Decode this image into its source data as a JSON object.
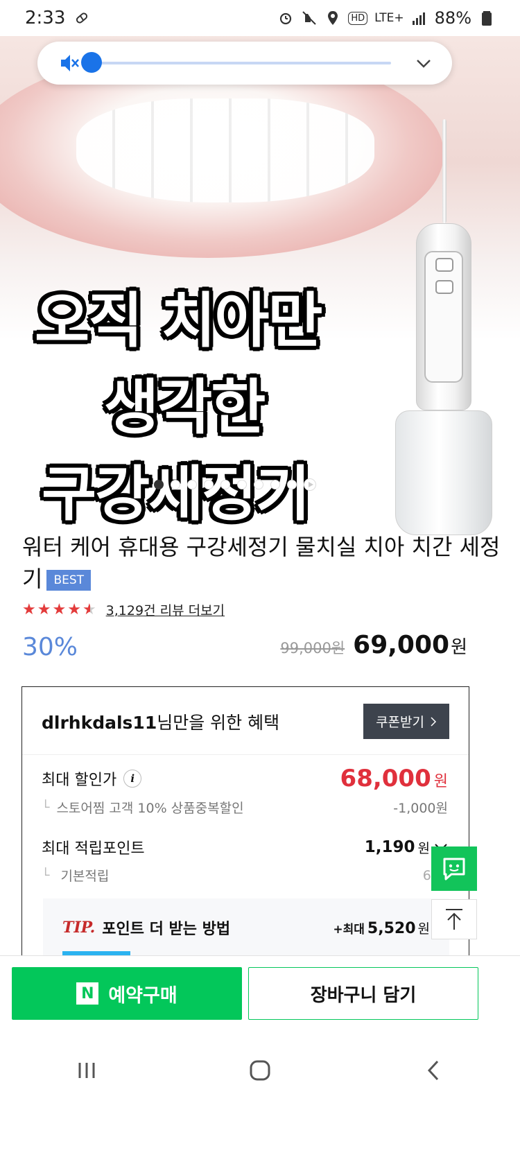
{
  "status_bar": {
    "time": "2:33",
    "network": "LTE+",
    "hd": "HD",
    "battery": "88%"
  },
  "volume": {
    "level": 0.0,
    "icons": [
      "mute-icon",
      "chevron-down-icon"
    ]
  },
  "hero": {
    "line1": "오직 치아만",
    "line2": "생각한",
    "line3": "구강세정기",
    "dots_total": 9,
    "dots_active": 0
  },
  "product": {
    "title": "워터 케어 휴대용 구강세정기 물치실 치아 치간 세정기",
    "badge": "BEST",
    "rating": 4.5,
    "review_link": "3,129건 리뷰 더보기",
    "discount": "30%",
    "original_price": "99,000원",
    "price": "69,000",
    "won": "원"
  },
  "benefit": {
    "user": "dlrhkdals11",
    "title_suffix": "님만을 위한 혜택",
    "coupon_button": "쿠폰받기",
    "max_discount_label": "최대 할인가",
    "info_icon_text": "i",
    "max_discount_price": "68,000",
    "won": "원",
    "store_label": "스토어찜 고객 10% 상품중복할인",
    "store_amount": "-1,000원",
    "max_point_label": "최대 적립포인트",
    "max_point_value": "1,190",
    "basic_label": "기본적립",
    "basic_value": "690",
    "tip_label": "TIP.",
    "tip_text": "포인트 더 받는 방법",
    "tip_prefix": "+최대",
    "tip_value": "5,520",
    "tip_won": "원"
  },
  "bottom": {
    "n_logo": "N",
    "buy_label": "예약구매",
    "cart_label": "장바구니 담기"
  },
  "colors": {
    "naver_green": "#03c75a",
    "discount_blue": "#5a88d9",
    "red_price": "#e0303c",
    "volume_blue": "#1a73e8"
  }
}
